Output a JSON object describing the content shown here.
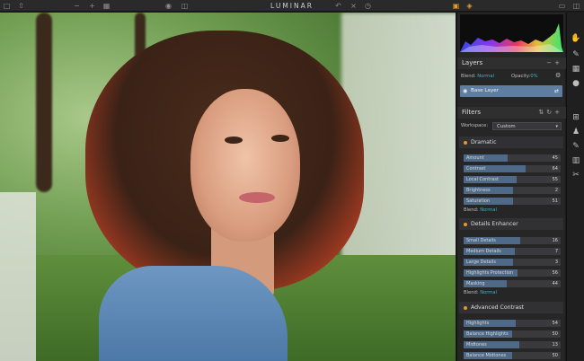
{
  "app": {
    "title": "LUMINAR"
  },
  "toolbar": {
    "icons": [
      "folder-icon",
      "share-icon",
      "minus-icon",
      "plus-icon",
      "fit-icon",
      "eye-icon",
      "compare-icon",
      "undo-icon",
      "redo-icon",
      "history-icon",
      "image-icon",
      "layers-icon",
      "window-icon",
      "window-split-icon"
    ]
  },
  "layers": {
    "title": "Layers",
    "blend_label": "Blend:",
    "blend_value": "Normal",
    "opacity_label": "Opacity:",
    "opacity_value": "0%",
    "base_layer": "Base Layer"
  },
  "filters": {
    "title": "Filters",
    "workspace_label": "Workspace:",
    "workspace_value": "Custom",
    "groups": [
      {
        "name": "Dramatic",
        "sliders": [
          {
            "label": "Amount",
            "value": "45",
            "level": 0.45
          },
          {
            "label": "Contrast",
            "value": "64",
            "level": 0.64
          },
          {
            "label": "Local Contrast",
            "value": "55",
            "level": 0.55
          },
          {
            "label": "Brightness",
            "value": "2",
            "level": 0.51
          },
          {
            "label": "Saturation",
            "value": "51",
            "level": 0.51
          }
        ],
        "blend_label": "Blend:",
        "blend_value": "Normal"
      },
      {
        "name": "Details Enhancer",
        "sliders": [
          {
            "label": "Small Details",
            "value": "16",
            "level": 0.58
          },
          {
            "label": "Medium Details",
            "value": "7",
            "level": 0.53
          },
          {
            "label": "Large Details",
            "value": "3",
            "level": 0.51
          },
          {
            "label": "Highlights Protection",
            "value": "56",
            "level": 0.56
          },
          {
            "label": "Masking",
            "value": "44",
            "level": 0.44
          }
        ],
        "blend_label": "Blend:",
        "blend_value": "Normal"
      },
      {
        "name": "Advanced Contrast",
        "sliders": [
          {
            "label": "Highlights",
            "value": "54",
            "level": 0.54
          },
          {
            "label": "Balance Highlights",
            "value": "50",
            "level": 0.5
          },
          {
            "label": "Midtones",
            "value": "13",
            "level": 0.57
          },
          {
            "label": "Balance Midtones",
            "value": "50",
            "level": 0.5
          }
        ]
      }
    ]
  },
  "colors": {
    "accent": "#e79a2a",
    "selection": "#5d7ea1",
    "slider_fill": "#4e6a88",
    "link": "#3bb3c7"
  }
}
